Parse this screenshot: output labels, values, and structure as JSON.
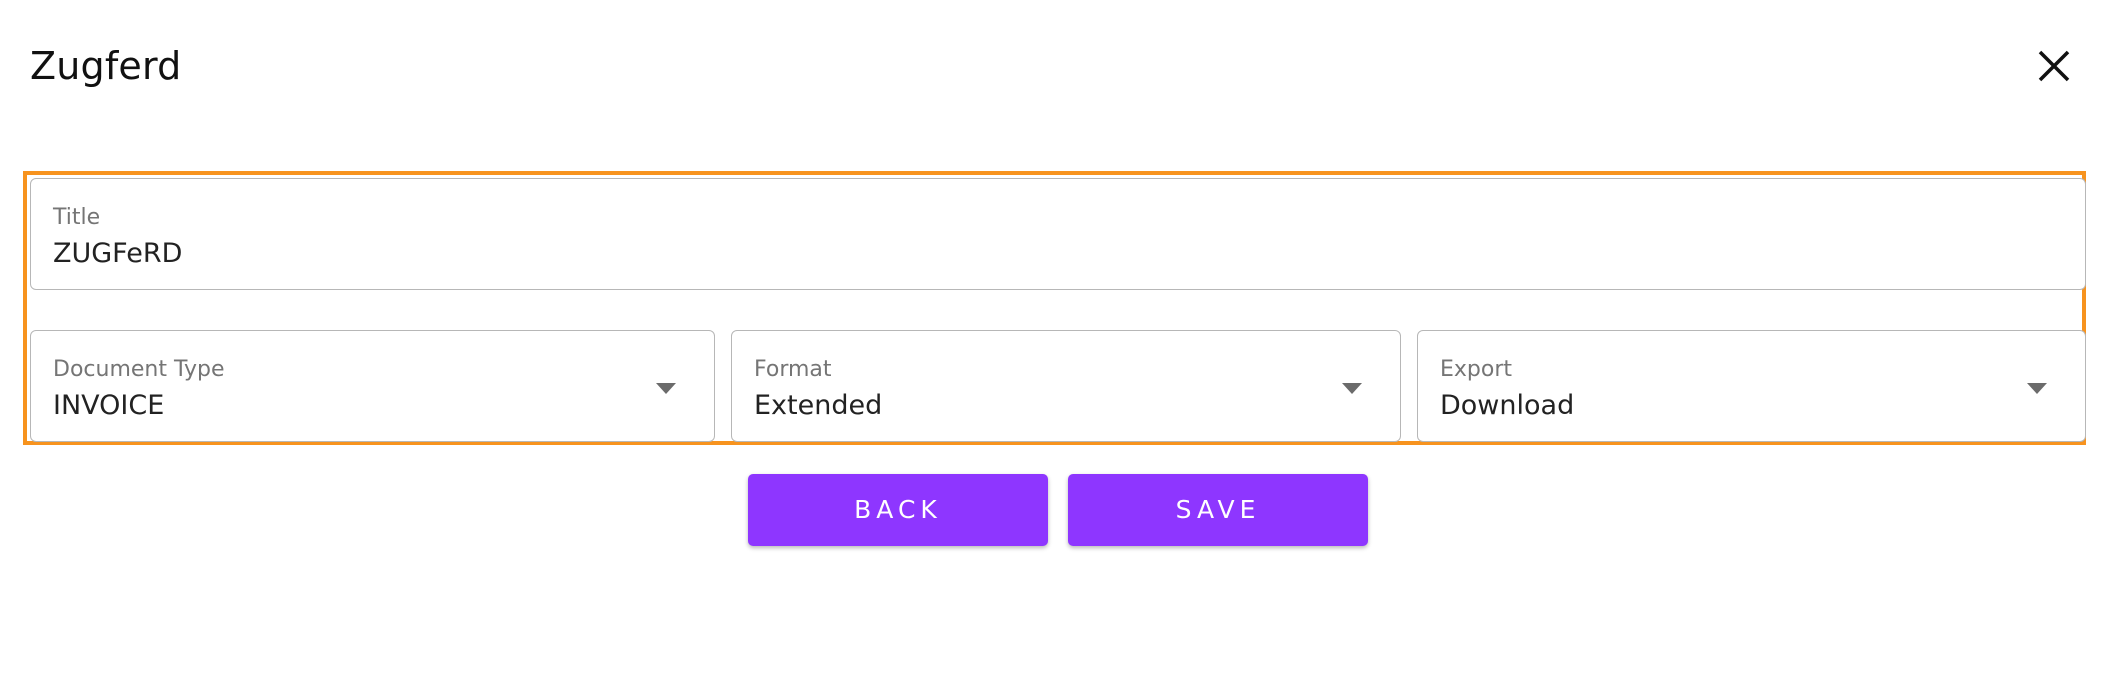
{
  "dialog": {
    "title": "Zugferd",
    "close_icon": "close-icon"
  },
  "form": {
    "title_field": {
      "label": "Title",
      "value": "ZUGFeRD"
    },
    "document_type": {
      "label": "Document Type",
      "value": "INVOICE",
      "icon": "chevron-down-icon"
    },
    "format": {
      "label": "Format",
      "value": "Extended",
      "icon": "chevron-down-icon"
    },
    "export": {
      "label": "Export",
      "value": "Download",
      "icon": "chevron-down-icon"
    }
  },
  "actions": {
    "back_label": "BACK",
    "save_label": "SAVE"
  },
  "colors": {
    "accent": "#8e36ff",
    "highlight": "#f7931e",
    "field_border": "#b7b7b7",
    "label": "#757575"
  }
}
